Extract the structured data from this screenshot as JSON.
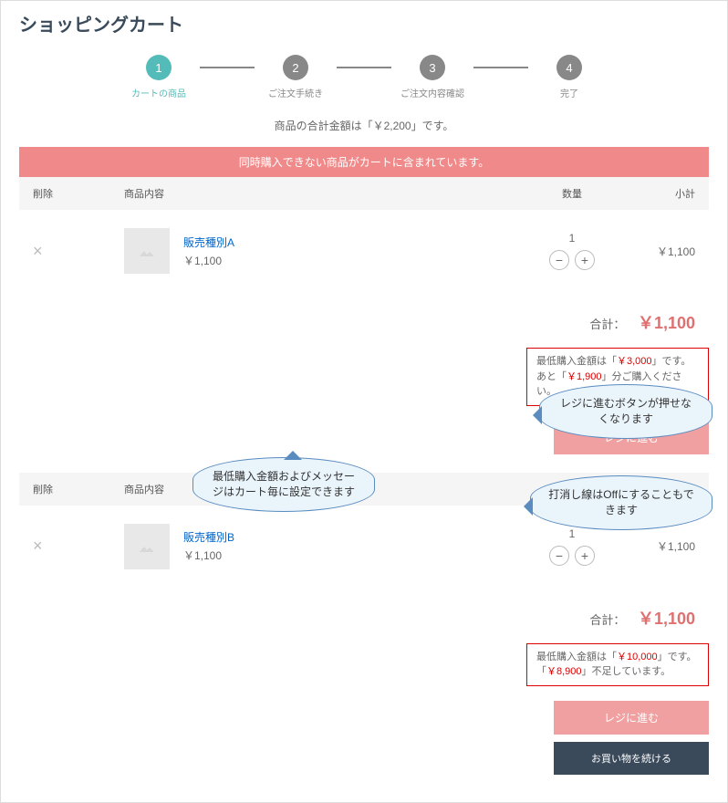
{
  "title": "ショッピングカート",
  "stepper": {
    "s1": {
      "num": "1",
      "label": "カートの商品"
    },
    "s2": {
      "num": "2",
      "label": "ご注文手続き"
    },
    "s3": {
      "num": "3",
      "label": "ご注文内容確認"
    },
    "s4": {
      "num": "4",
      "label": "完了"
    }
  },
  "totalLine": "商品の合計金額は「￥2,200」です。",
  "banner": "同時購入できない商品がカートに含まれています。",
  "headers": {
    "del": "削除",
    "desc": "商品内容",
    "qty": "数量",
    "sub": "小計"
  },
  "cartA": {
    "name": "販売種別A",
    "price": "￥1,100",
    "qty": "1",
    "sub": "￥1,100",
    "totalLabel": "合計：",
    "totalVal": "￥1,100",
    "min1": "最低購入金額は「",
    "min1b": "￥3,000",
    "min1c": "」です。",
    "min2a": "あと「",
    "min2b": "￥1,900",
    "min2c": "」分ご購入ください。",
    "checkout": "レジに進む"
  },
  "cartB": {
    "name": "販売種別B",
    "price": "￥1,100",
    "qty": "1",
    "sub": "￥1,100",
    "totalLabel": "合計：",
    "totalVal": "￥1,100",
    "min1": "最低購入金額は「",
    "min1b": "￥10,000",
    "min1c": "」です。",
    "min2a": "「",
    "min2b": "￥8,900",
    "min2c": "」不足しています。",
    "checkout": "レジに進む",
    "continue": "お買い物を続ける"
  },
  "callouts": {
    "c1": "最低購入金額およびメッセージはカート毎に設定できます",
    "c2": "レジに進むボタンが押せなくなります",
    "c3": "打消し線はOffにすることもできます"
  }
}
